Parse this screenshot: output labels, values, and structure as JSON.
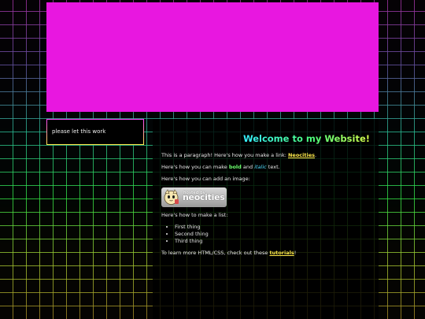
{
  "sidebar": {
    "text": "please let this work"
  },
  "main": {
    "heading": "Welcome to my Website!",
    "paragraph_link_prefix": "This is a paragraph! Here's how you make a link: ",
    "paragraph_link_text": "Neocities",
    "paragraph_link_suffix": ".",
    "format_prefix": "Here's how you can make ",
    "bold_text": "bold",
    "format_middle": " and ",
    "italic_text": "italic",
    "format_suffix": " text.",
    "image_intro": "Here's how you can add an image:",
    "badge_small": "hosted by",
    "badge_big": "neocities",
    "list_intro": "Here's how to make a list:",
    "list_items": [
      "First thing",
      "Second thing",
      "Third thing"
    ],
    "tutorial_prefix": "To learn more HTML/CSS, check out these ",
    "tutorial_link": "tutorials",
    "tutorial_suffix": "!"
  },
  "colors": {
    "banner": "#e817e0",
    "link": "#ffe94a",
    "bold": "#6cff6c",
    "italic": "#4fe0ff"
  },
  "icons": [
    "neocities-cat-icon"
  ]
}
